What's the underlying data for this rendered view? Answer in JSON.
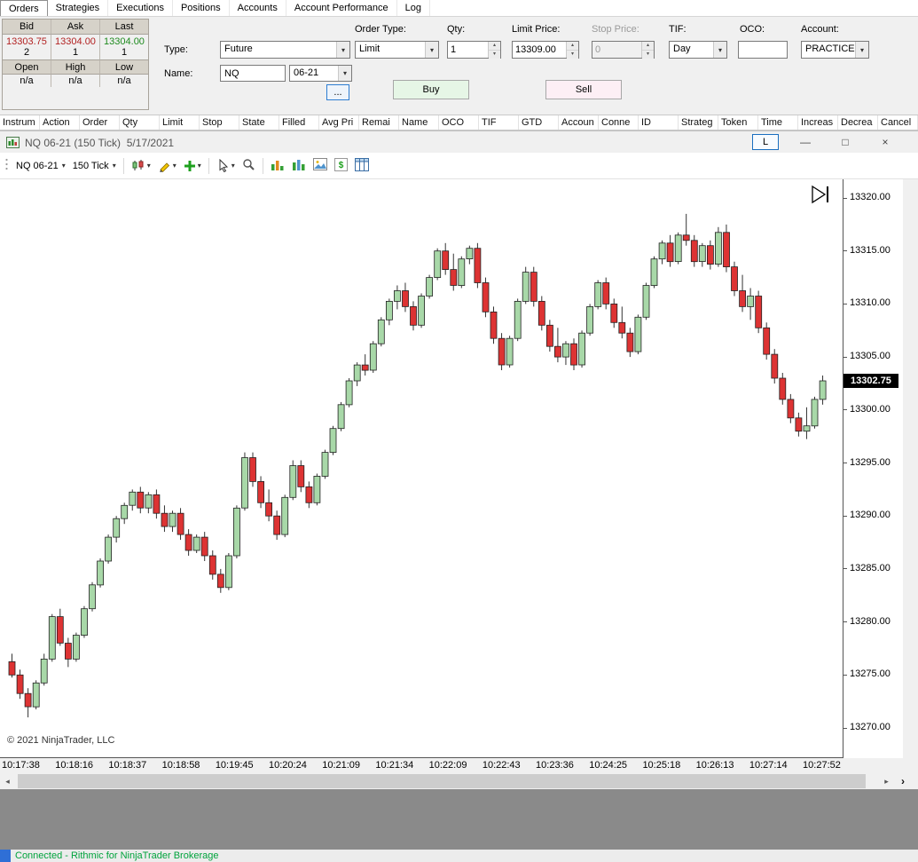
{
  "tabs": {
    "items": [
      {
        "label": "Orders",
        "active": true
      },
      {
        "label": "Strategies",
        "active": false
      },
      {
        "label": "Executions",
        "active": false
      },
      {
        "label": "Positions",
        "active": false
      },
      {
        "label": "Accounts",
        "active": false
      },
      {
        "label": "Account Performance",
        "active": false
      },
      {
        "label": "Log",
        "active": false
      }
    ]
  },
  "icons": {
    "caret": "▾",
    "up": "▴",
    "down": "▾",
    "left_arrow": "◂",
    "right_arrow": "▸",
    "expand": "›",
    "minimize": "—",
    "maximize": "□",
    "close": "×"
  },
  "quote_panel": {
    "headers1": [
      "Bid",
      "Ask",
      "Last"
    ],
    "bid": {
      "price": "13303.75",
      "size": "2"
    },
    "ask": {
      "price": "13304.00",
      "size": "1"
    },
    "last": {
      "price": "13304.00",
      "size": "1"
    },
    "headers2": [
      "Open",
      "High",
      "Low"
    ],
    "open": "n/a",
    "high": "n/a",
    "low": "n/a"
  },
  "order_entry": {
    "type_label": "Type:",
    "type_value": "Future",
    "name_label": "Name:",
    "name_value": "NQ",
    "expiry_value": "06-21",
    "order_type_label": "Order Type:",
    "order_type_value": "Limit",
    "qty_label": "Qty:",
    "qty_value": "1",
    "limit_price_label": "Limit Price:",
    "limit_price_value": "13309.00",
    "stop_price_label": "Stop Price:",
    "stop_price_value": "0",
    "tif_label": "TIF:",
    "tif_value": "Day",
    "oco_label": "OCO:",
    "oco_value": "",
    "account_label": "Account:",
    "account_value": "PRACTICE!",
    "more_button": "...",
    "buy_label": "Buy",
    "sell_label": "Sell"
  },
  "orders_grid": {
    "columns": [
      "Instrum",
      "Action",
      "Order",
      "Qty",
      "Limit",
      "Stop",
      "State",
      "Filled",
      "Avg Pri",
      "Remai",
      "Name",
      "OCO",
      "TIF",
      "GTD",
      "Accoun",
      "Conne",
      "ID",
      "Strateg",
      "Token",
      "Time",
      "Increas",
      "Decrea",
      "Cancel"
    ]
  },
  "chart_window": {
    "title": "NQ 06-21 (150 Tick)  5/17/2021",
    "link_button": "L",
    "instrument": "NQ 06-21",
    "interval": "150 Tick",
    "copyright": "© 2021 NinjaTrader, LLC",
    "last_price": "13302.75"
  },
  "chart_data": {
    "type": "candlestick",
    "symbol": "NQ 06-21",
    "interval": "150 Tick",
    "date": "5/17/2021",
    "ylim": [
      13267.2,
      13321.8
    ],
    "grid": false,
    "legend": false,
    "y_ticks": [
      "13320.00",
      "13315.00",
      "13310.00",
      "13305.00",
      "13300.00",
      "13295.00",
      "13290.00",
      "13285.00",
      "13280.00",
      "13275.00",
      "13270.00"
    ],
    "x_labels": [
      "10:17:38",
      "10:18:16",
      "10:18:37",
      "10:18:58",
      "10:19:45",
      "10:20:24",
      "10:21:09",
      "10:21:34",
      "10:22:09",
      "10:22:43",
      "10:23:36",
      "10:24:25",
      "10:25:18",
      "10:26:13",
      "10:27:14",
      "10:27:52"
    ],
    "last_price": 13302.75,
    "up_color": "#a8d8a8",
    "down_color": "#dd3333",
    "candles": [
      [
        13276.25,
        13277.0,
        13274.75,
        13275.0
      ],
      [
        13275.0,
        13275.5,
        13272.75,
        13273.25
      ],
      [
        13273.25,
        13273.75,
        13271.0,
        13272.0
      ],
      [
        13272.0,
        13274.5,
        13271.75,
        13274.25
      ],
      [
        13274.25,
        13277.0,
        13274.0,
        13276.5
      ],
      [
        13276.5,
        13280.75,
        13276.25,
        13280.5
      ],
      [
        13280.5,
        13281.25,
        13277.75,
        13278.0
      ],
      [
        13278.0,
        13278.5,
        13275.75,
        13276.5
      ],
      [
        13276.5,
        13279.0,
        13276.25,
        13278.75
      ],
      [
        13278.75,
        13281.5,
        13278.5,
        13281.25
      ],
      [
        13281.25,
        13283.75,
        13281.0,
        13283.5
      ],
      [
        13283.5,
        13286.0,
        13283.25,
        13285.75
      ],
      [
        13285.75,
        13288.25,
        13285.5,
        13288.0
      ],
      [
        13288.0,
        13290.0,
        13287.5,
        13289.75
      ],
      [
        13289.75,
        13291.25,
        13289.25,
        13291.0
      ],
      [
        13291.0,
        13292.5,
        13290.5,
        13292.25
      ],
      [
        13292.25,
        13292.75,
        13290.25,
        13290.75
      ],
      [
        13290.75,
        13292.25,
        13290.25,
        13292.0
      ],
      [
        13292.0,
        13292.5,
        13289.75,
        13290.25
      ],
      [
        13290.25,
        13291.0,
        13288.5,
        13289.0
      ],
      [
        13289.0,
        13290.5,
        13288.5,
        13290.25
      ],
      [
        13290.25,
        13290.75,
        13287.75,
        13288.25
      ],
      [
        13288.25,
        13288.75,
        13286.25,
        13286.75
      ],
      [
        13286.75,
        13288.25,
        13286.5,
        13288.0
      ],
      [
        13288.0,
        13288.5,
        13285.75,
        13286.25
      ],
      [
        13286.25,
        13286.75,
        13284.0,
        13284.5
      ],
      [
        13284.5,
        13285.0,
        13282.75,
        13283.25
      ],
      [
        13283.25,
        13286.5,
        13283.0,
        13286.25
      ],
      [
        13286.25,
        13291.0,
        13286.0,
        13290.75
      ],
      [
        13290.75,
        13296.0,
        13290.5,
        13295.5
      ],
      [
        13295.5,
        13296.0,
        13292.75,
        13293.25
      ],
      [
        13293.25,
        13293.75,
        13290.75,
        13291.25
      ],
      [
        13291.25,
        13292.5,
        13289.5,
        13290.0
      ],
      [
        13290.0,
        13290.5,
        13287.75,
        13288.25
      ],
      [
        13288.25,
        13292.0,
        13288.0,
        13291.75
      ],
      [
        13291.75,
        13295.25,
        13291.5,
        13294.75
      ],
      [
        13294.75,
        13295.25,
        13292.25,
        13292.75
      ],
      [
        13292.75,
        13293.25,
        13290.75,
        13291.25
      ],
      [
        13291.25,
        13294.0,
        13291.0,
        13293.75
      ],
      [
        13293.75,
        13296.25,
        13293.5,
        13296.0
      ],
      [
        13296.0,
        13298.5,
        13295.75,
        13298.25
      ],
      [
        13298.25,
        13300.75,
        13298.0,
        13300.5
      ],
      [
        13300.5,
        13303.0,
        13300.25,
        13302.75
      ],
      [
        13302.75,
        13304.5,
        13302.25,
        13304.25
      ],
      [
        13304.25,
        13305.25,
        13303.25,
        13303.75
      ],
      [
        13303.75,
        13306.5,
        13303.5,
        13306.25
      ],
      [
        13306.25,
        13308.75,
        13306.0,
        13308.5
      ],
      [
        13308.5,
        13310.5,
        13308.0,
        13310.25
      ],
      [
        13310.25,
        13311.75,
        13309.5,
        13311.25
      ],
      [
        13311.25,
        13312.0,
        13309.25,
        13309.75
      ],
      [
        13309.75,
        13310.25,
        13307.5,
        13308.0
      ],
      [
        13308.0,
        13311.0,
        13307.75,
        13310.75
      ],
      [
        13310.75,
        13312.75,
        13310.5,
        13312.5
      ],
      [
        13312.5,
        13315.25,
        13312.25,
        13315.0
      ],
      [
        13315.0,
        13315.75,
        13312.75,
        13313.25
      ],
      [
        13313.25,
        13314.75,
        13311.25,
        13311.75
      ],
      [
        13311.75,
        13314.5,
        13311.5,
        13314.25
      ],
      [
        13314.25,
        13315.5,
        13313.75,
        13315.25
      ],
      [
        13315.25,
        13315.75,
        13311.5,
        13312.0
      ],
      [
        13312.0,
        13312.5,
        13308.75,
        13309.25
      ],
      [
        13309.25,
        13309.75,
        13306.25,
        13306.75
      ],
      [
        13306.75,
        13307.25,
        13303.75,
        13304.25
      ],
      [
        13304.25,
        13307.0,
        13304.0,
        13306.75
      ],
      [
        13306.75,
        13310.5,
        13306.5,
        13310.25
      ],
      [
        13310.25,
        13313.5,
        13310.0,
        13313.0
      ],
      [
        13313.0,
        13313.5,
        13309.75,
        13310.25
      ],
      [
        13310.25,
        13310.75,
        13307.5,
        13308.0
      ],
      [
        13308.0,
        13308.5,
        13305.5,
        13306.0
      ],
      [
        13306.0,
        13307.75,
        13304.5,
        13305.0
      ],
      [
        13305.0,
        13306.5,
        13304.25,
        13306.25
      ],
      [
        13306.25,
        13306.75,
        13303.75,
        13304.25
      ],
      [
        13304.25,
        13307.5,
        13304.0,
        13307.25
      ],
      [
        13307.25,
        13310.0,
        13307.0,
        13309.75
      ],
      [
        13309.75,
        13312.25,
        13309.5,
        13312.0
      ],
      [
        13312.0,
        13312.5,
        13309.5,
        13310.0
      ],
      [
        13310.0,
        13310.5,
        13307.75,
        13308.25
      ],
      [
        13308.25,
        13309.75,
        13306.75,
        13307.25
      ],
      [
        13307.25,
        13307.75,
        13305.0,
        13305.5
      ],
      [
        13305.5,
        13309.0,
        13305.25,
        13308.75
      ],
      [
        13308.75,
        13312.0,
        13308.5,
        13311.75
      ],
      [
        13311.75,
        13314.5,
        13311.5,
        13314.25
      ],
      [
        13314.25,
        13316.0,
        13313.75,
        13315.75
      ],
      [
        13315.75,
        13316.5,
        13313.5,
        13314.0
      ],
      [
        13314.0,
        13316.75,
        13313.75,
        13316.5
      ],
      [
        13316.5,
        13318.5,
        13315.5,
        13316.0
      ],
      [
        13316.0,
        13316.5,
        13313.5,
        13314.0
      ],
      [
        13314.0,
        13315.75,
        13313.5,
        13315.5
      ],
      [
        13315.5,
        13316.0,
        13313.25,
        13313.75
      ],
      [
        13313.75,
        13317.25,
        13313.5,
        13316.75
      ],
      [
        13316.75,
        13317.5,
        13313.0,
        13313.5
      ],
      [
        13313.5,
        13314.0,
        13310.75,
        13311.25
      ],
      [
        13311.25,
        13312.75,
        13309.25,
        13309.75
      ],
      [
        13309.75,
        13311.5,
        13308.5,
        13310.75
      ],
      [
        13310.75,
        13311.25,
        13307.25,
        13307.75
      ],
      [
        13307.75,
        13308.25,
        13304.75,
        13305.25
      ],
      [
        13305.25,
        13305.75,
        13302.5,
        13303.0
      ],
      [
        13303.0,
        13303.5,
        13300.5,
        13301.0
      ],
      [
        13301.0,
        13301.5,
        13298.75,
        13299.25
      ],
      [
        13299.25,
        13299.75,
        13297.5,
        13298.0
      ],
      [
        13298.0,
        13300.25,
        13297.25,
        13298.5
      ],
      [
        13298.5,
        13301.25,
        13298.25,
        13301.0
      ],
      [
        13301.0,
        13303.25,
        13300.5,
        13302.75
      ]
    ]
  },
  "status_bar": {
    "text": "Connected - Rithmic for NinjaTrader Brokerage"
  }
}
